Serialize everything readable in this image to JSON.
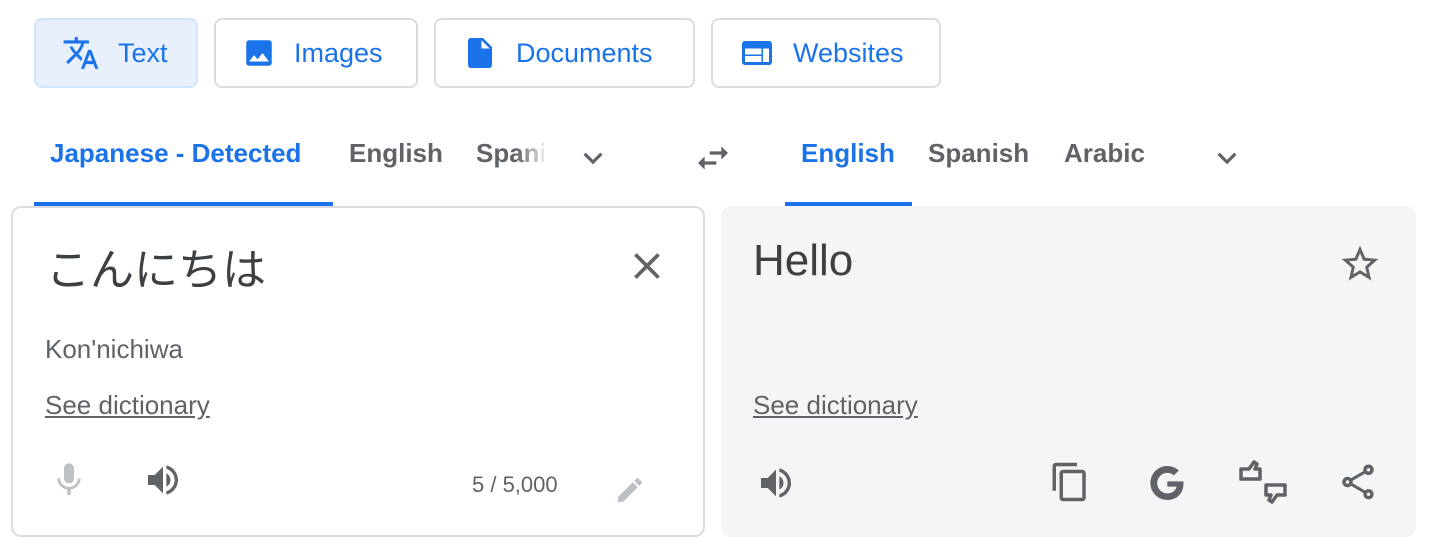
{
  "modes": [
    {
      "label": "Text",
      "icon": "translate-icon",
      "active": true
    },
    {
      "label": "Images",
      "icon": "image-icon",
      "active": false
    },
    {
      "label": "Documents",
      "icon": "document-icon",
      "active": false
    },
    {
      "label": "Websites",
      "icon": "website-icon",
      "active": false
    }
  ],
  "source_languages": {
    "tabs": [
      "Japanese - Detected",
      "English",
      "Spanish"
    ],
    "active_index": 0
  },
  "target_languages": {
    "tabs": [
      "English",
      "Spanish",
      "Arabic"
    ],
    "active_index": 0
  },
  "source": {
    "text": "こんにちは",
    "transliteration": "Kon'nichiwa",
    "dictionary_link": "See dictionary",
    "char_count": "5 / 5,000"
  },
  "target": {
    "text": "Hello",
    "dictionary_link": "See dictionary"
  },
  "colors": {
    "accent": "#1a73e8",
    "text_dark": "#3c4043",
    "text_muted": "#5f6368",
    "icon_disabled": "#bdc1c6",
    "target_panel_bg": "#f5f5f5"
  }
}
